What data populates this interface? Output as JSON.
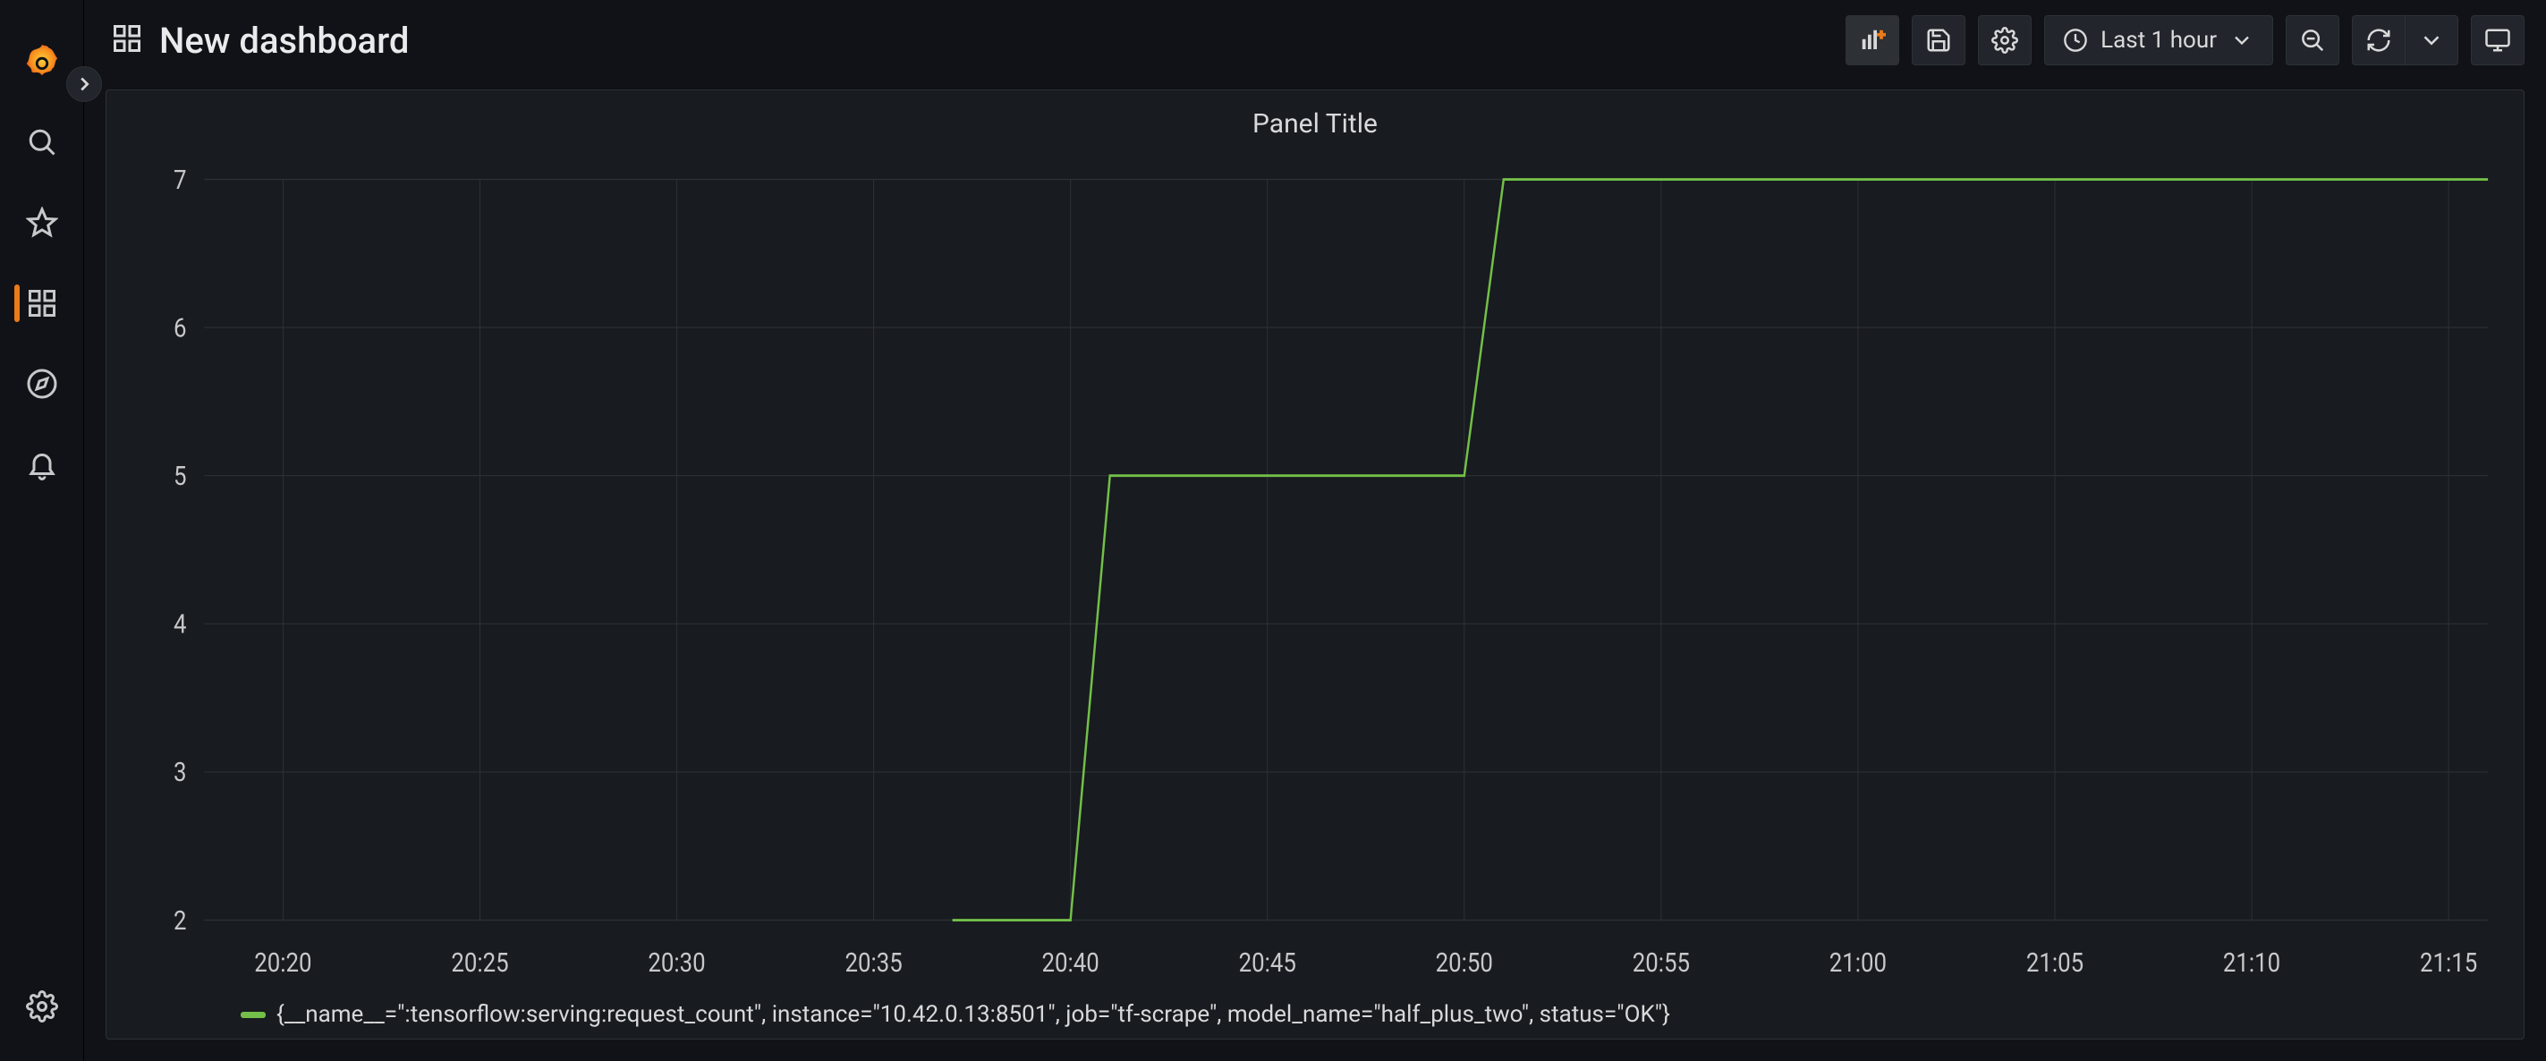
{
  "header": {
    "title": "New dashboard",
    "time_range_label": "Last 1 hour"
  },
  "panel": {
    "title": "Panel Title",
    "legend_label": "{__name__=\":tensorflow:serving:request_count\", instance=\"10.42.0.13:8501\", job=\"tf-scrape\", model_name=\"half_plus_two\", status=\"OK\"}"
  },
  "chart_data": {
    "type": "line",
    "title": "Panel Title",
    "xlabel": "",
    "ylabel": "",
    "ylim": [
      2,
      7
    ],
    "y_ticks": [
      2,
      3,
      4,
      5,
      6,
      7
    ],
    "x_ticks": [
      "20:20",
      "20:25",
      "20:30",
      "20:35",
      "20:40",
      "20:45",
      "20:50",
      "20:55",
      "21:00",
      "21:05",
      "21:10",
      "21:15"
    ],
    "x_range_minutes": {
      "start": "20:18",
      "end": "21:16"
    },
    "series": [
      {
        "name": "{__name__=\":tensorflow:serving:request_count\", instance=\"10.42.0.13:8501\", job=\"tf-scrape\", model_name=\"half_plus_two\", status=\"OK\"}",
        "color": "#73bf49",
        "points": [
          {
            "t": "20:37",
            "v": 2
          },
          {
            "t": "20:40",
            "v": 2
          },
          {
            "t": "20:41",
            "v": 5
          },
          {
            "t": "20:50",
            "v": 5
          },
          {
            "t": "20:51",
            "v": 7
          },
          {
            "t": "21:16",
            "v": 7
          }
        ]
      }
    ]
  }
}
